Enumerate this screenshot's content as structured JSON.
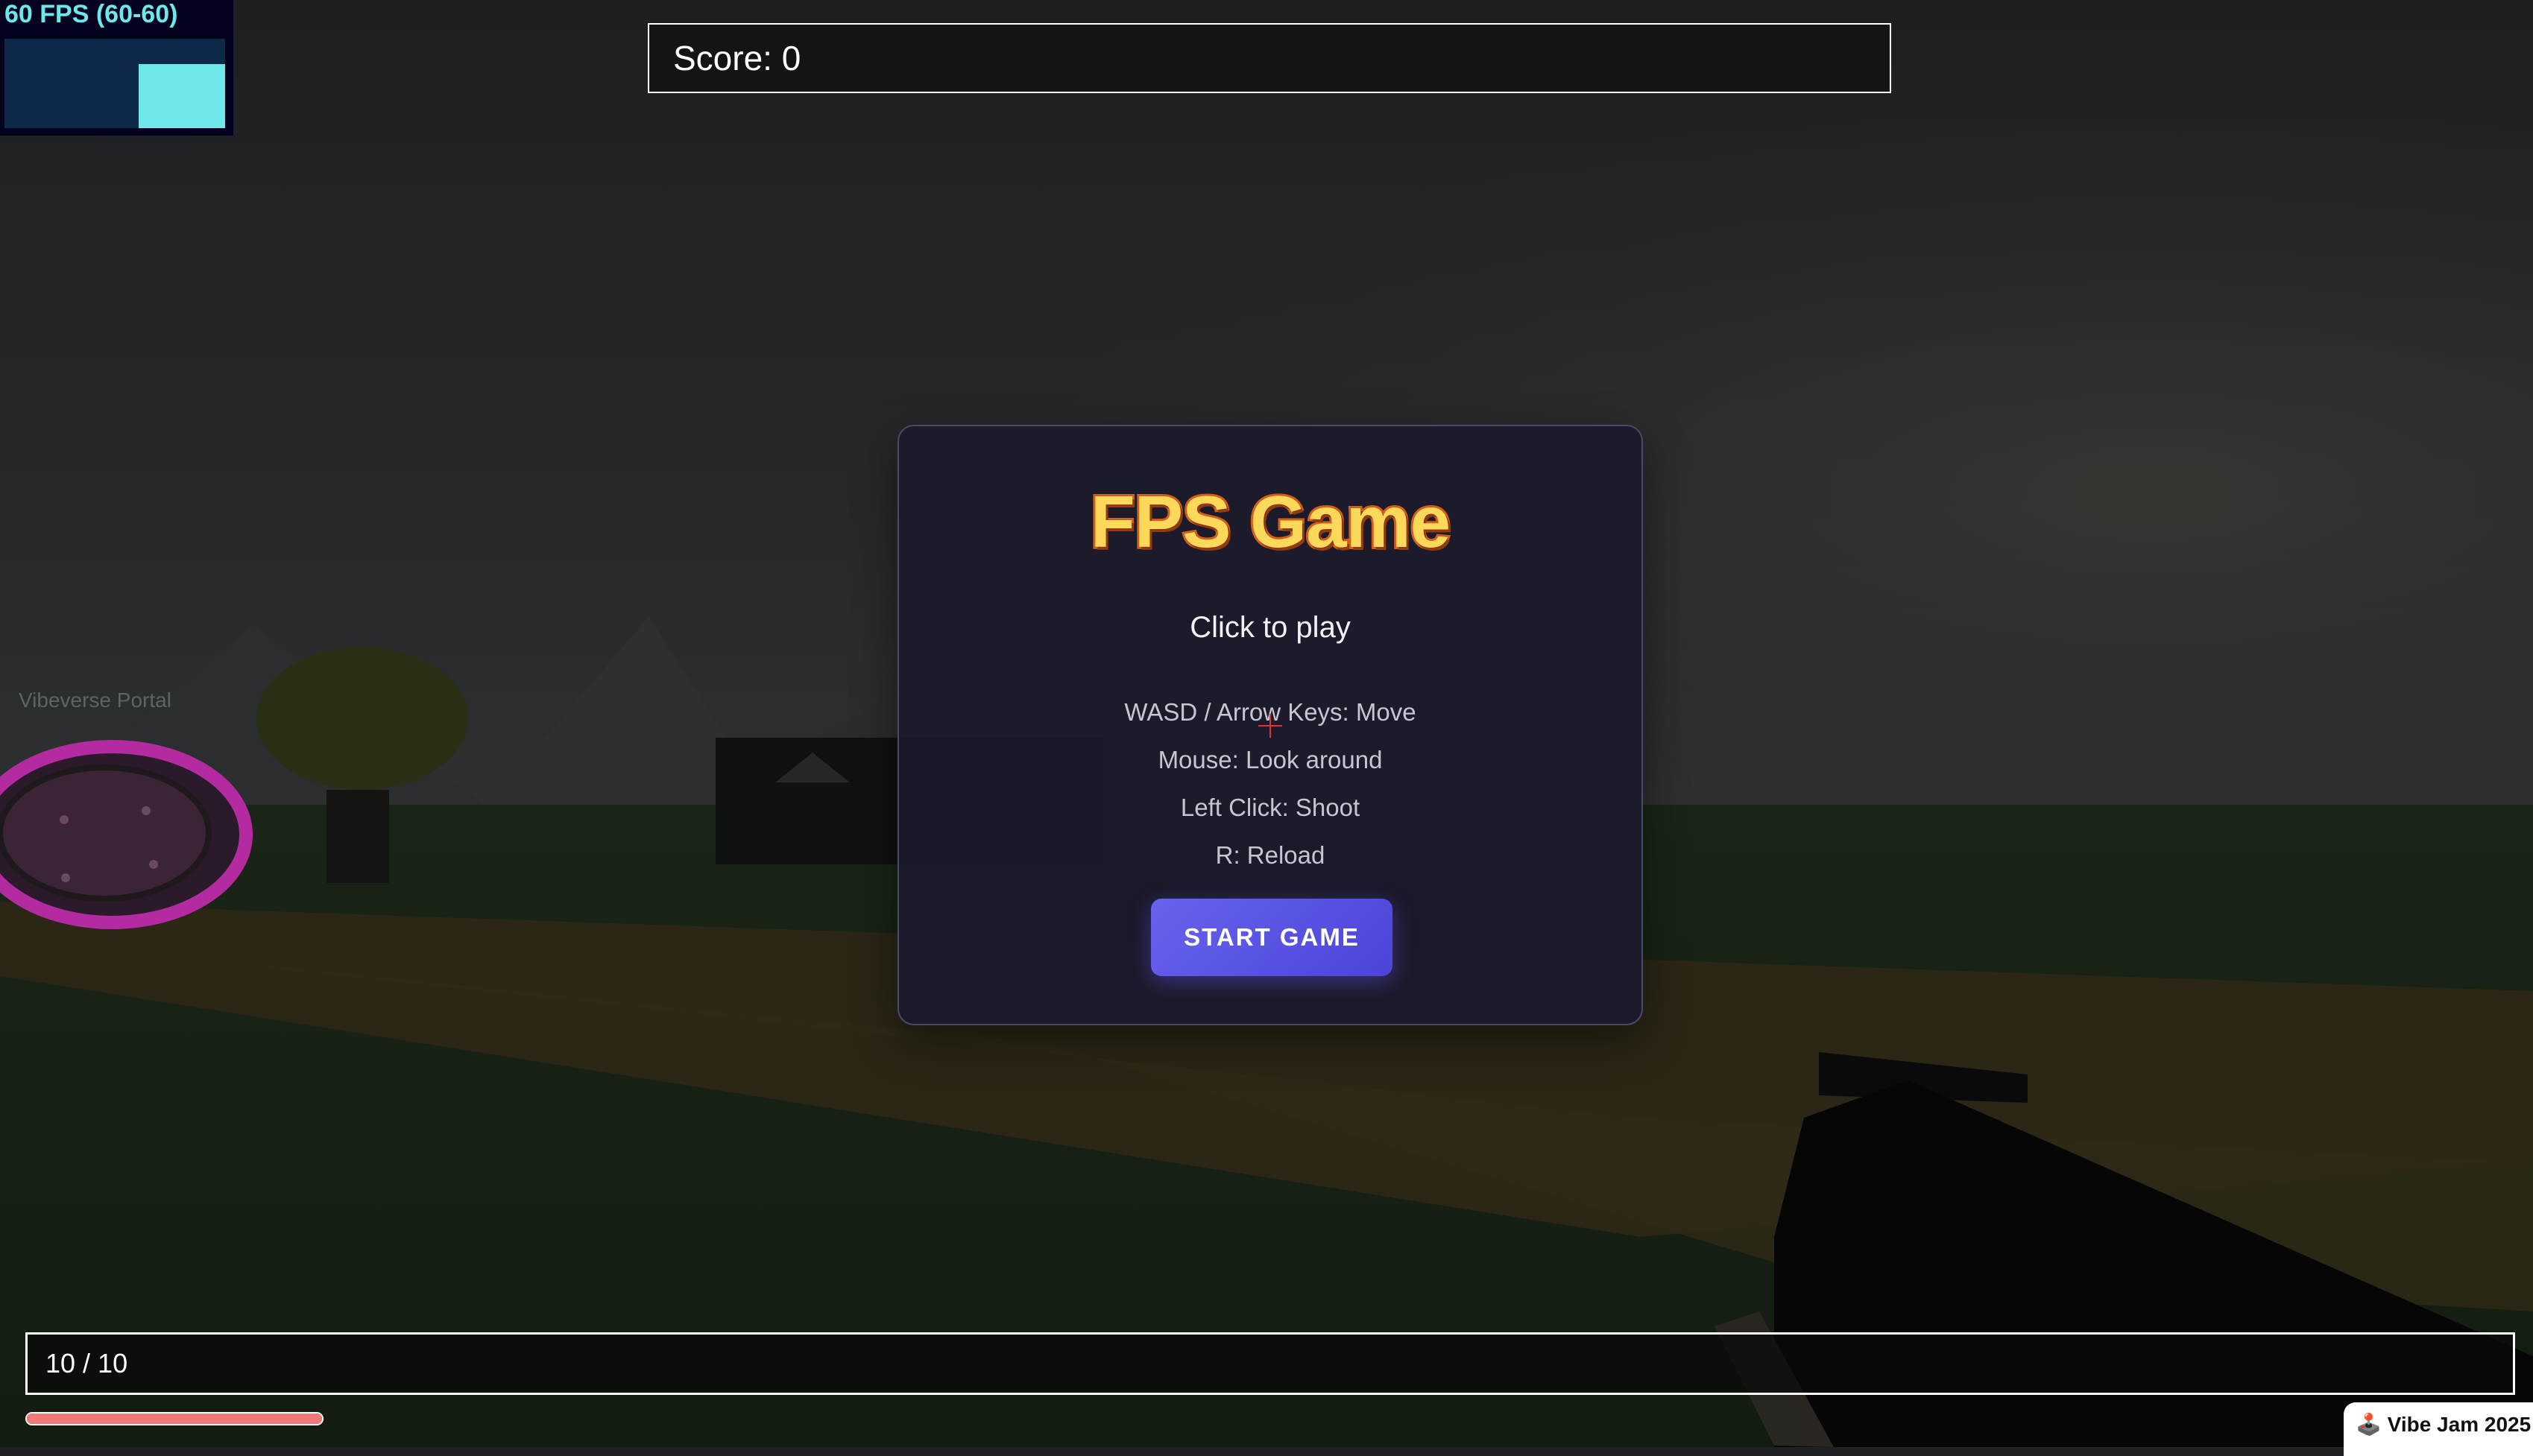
{
  "fps_meter": {
    "label": "60 FPS (60-60)",
    "bar_fill_fraction": 0.72,
    "color": "#6ee7ea"
  },
  "hud": {
    "score_label": "Score: 0",
    "ammo_label": "10 / 10",
    "health_fraction": 1.0,
    "health_color": "#f07878"
  },
  "world": {
    "portal_label": "Vibeverse Portal",
    "portal_color": "#c02aa8"
  },
  "menu": {
    "title": "FPS Game",
    "subtitle": "Click to play",
    "controls": [
      "WASD / Arrow Keys: Move",
      "Mouse: Look around",
      "Left Click: Shoot",
      "R: Reload"
    ],
    "start_button_label": "START GAME",
    "accent_color": "#5a54e6",
    "title_color": "#fcd95a"
  },
  "badge": {
    "icon": "joystick-icon",
    "label": "Vibe Jam 2025"
  }
}
